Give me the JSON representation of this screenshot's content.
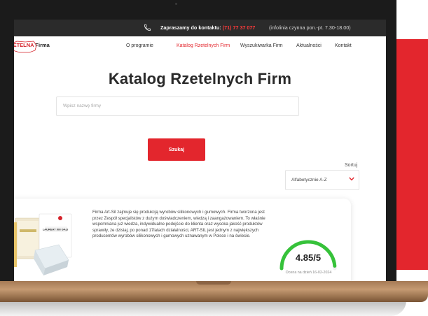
{
  "topbar": {
    "contact_label": "Zapraszamy do kontaktu:",
    "phone": "(71) 77 37 077",
    "hours": "(infolinia czynna pon.-pt. 7.30-18.00)"
  },
  "logo": {
    "brand": "ZETELNA",
    "suffix": "Firma"
  },
  "nav": [
    {
      "label": "O programie"
    },
    {
      "label": "Katalog Rzetelnych Firm",
      "active": true
    },
    {
      "label": "Wyszukiwarka Firm"
    },
    {
      "label": "Aktualności"
    },
    {
      "label": "Kontakt"
    }
  ],
  "page": {
    "title": "Katalog Rzetelnych Firm"
  },
  "search": {
    "placeholder": "Wpisz nazwę firmy",
    "button": "Szukaj"
  },
  "sort": {
    "label": "Sortuj",
    "value": "Alfabetycznie A-Z"
  },
  "company": {
    "image_label": "LAUREAT XIII GALI",
    "description": "Firma Art-Sil zajmuje się produkcją wyrobów silikonowych i gumowych. Firma tworzona jest przez Zespół specjalistów z dużym doświadczeniem, wiedzą i zaangażowaniem. To właśnie wspomniana już wiedza, indywidualne podejście do klienta oraz wysoka jakość produktów sprawiły, że dzisiaj, po ponad 17latach działalności, ART-SIL jest jednym z największych producentów wyrobów silikonowych i gumowych uznawanym w Polsce i na świecie.",
    "score": "4.85/5",
    "score_value": 4.85,
    "score_max": 5,
    "rating_date": "Ocena na dzień 16-02-2024"
  },
  "colors": {
    "accent": "#e3262d",
    "gauge": "#36c23a",
    "topbar": "#2b2b2b"
  }
}
